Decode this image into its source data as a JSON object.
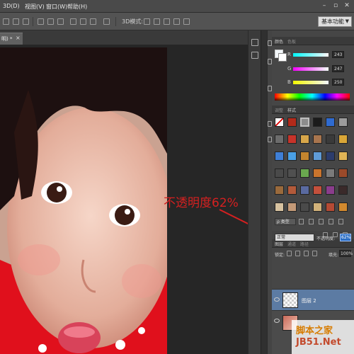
{
  "menubar": {
    "items": [
      "3D(D)",
      "视图(V)",
      "窗口(W)",
      "帮助(H)"
    ],
    "window_controls": [
      "–",
      "▫",
      "✕"
    ]
  },
  "options_bar": {
    "mode_label": "3D模式:",
    "workspace": "基本功能"
  },
  "document": {
    "tab_label": "明) *",
    "close": "×"
  },
  "annotation": {
    "text": "不透明度62%",
    "color": "#d62020"
  },
  "color_panel": {
    "tabs": [
      "颜色",
      "色板"
    ],
    "channels": [
      {
        "label": "R",
        "value": "243"
      },
      {
        "label": "G",
        "value": "247"
      },
      {
        "label": "B",
        "value": "250"
      }
    ],
    "foreground_color": "#f3f7fa"
  },
  "styles_panel": {
    "tabs": [
      "调整",
      "样式"
    ]
  },
  "layers_panel": {
    "tabs": [
      "图层",
      "通道",
      "路径"
    ],
    "kind_filter": "ρ 类型",
    "blend_mode": "正常",
    "opacity_label": "不透明度:",
    "opacity_value": "62%",
    "lock_label": "锁定:",
    "fill_label": "填充:",
    "fill_value": "100%",
    "layers": [
      {
        "name": "图层 2",
        "selected": true
      },
      {
        "name": "",
        "selected": false
      }
    ]
  },
  "watermark": {
    "line1": "脚本之家",
    "line2": "JB51.Net"
  }
}
